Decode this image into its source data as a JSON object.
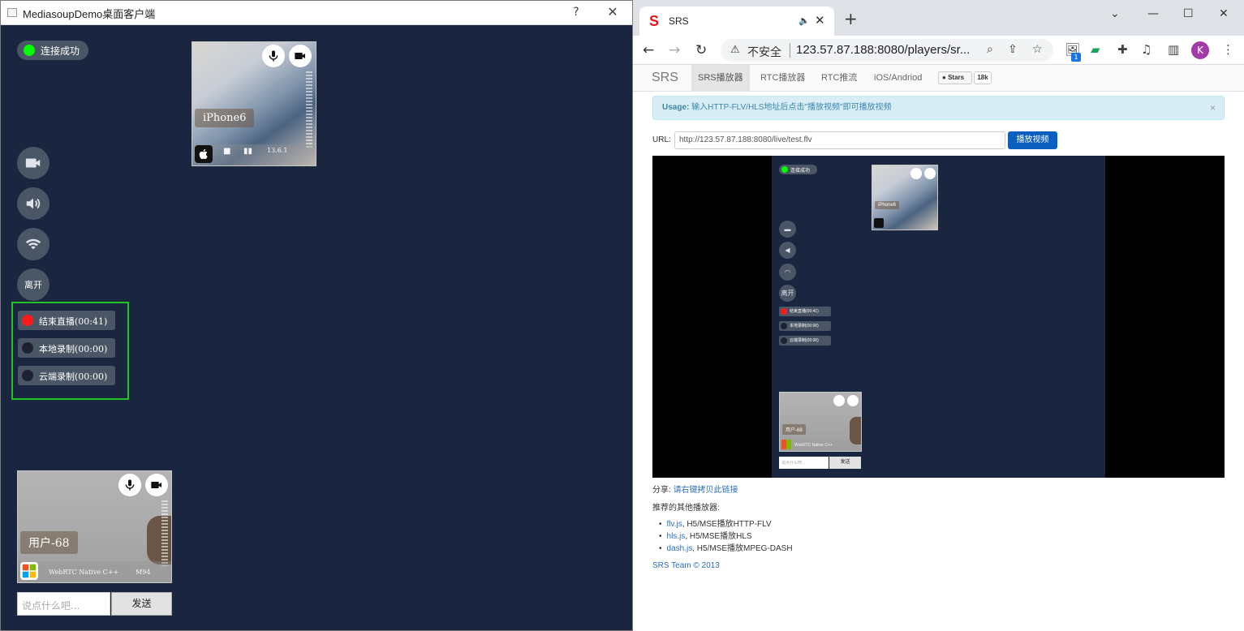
{
  "left_window": {
    "title": "MediasoupDemo桌面客户端",
    "help": "?",
    "close": "✕",
    "status_text": "连接成功",
    "leave_label": "离开",
    "recordings": [
      {
        "label": "结束直播(00:41)",
        "color": "#ff1a1a",
        "active": true
      },
      {
        "label": "本地录制(00:00)",
        "color": "#1d2230",
        "active": false
      },
      {
        "label": "云端录制(00:00)",
        "color": "#1d2230",
        "active": false
      }
    ],
    "remote_tile": {
      "name": "iPhone6",
      "version": "13.6.1"
    },
    "local_tile": {
      "name": "用户-68",
      "sdk": "WebRTC Native C++",
      "version": "M94"
    },
    "chat_placeholder": "说点什么吧...",
    "send_label": "发送"
  },
  "browser": {
    "tab_title": "SRS",
    "new_tab": "+",
    "insecure_label": "不安全",
    "url": "123.57.87.188:8080/players/sr...",
    "profile_initial": "K",
    "extension_badge": "1",
    "page": {
      "brand": "SRS",
      "nav": [
        "SRS播放器",
        "RTC播放器",
        "RTC推流",
        "iOS/Andriod"
      ],
      "github_stars_label": "Stars",
      "github_stars_count": "18k",
      "usage_label": "Usage:",
      "usage_text": "输入HTTP-FLV/HLS地址后点击\"播放视频\"即可播放视频",
      "url_label": "URL:",
      "url_value": "http://123.57.87.188:8080/live/test.flv",
      "play_label": "播放视频",
      "share_label": "分享:",
      "share_link": "请右键拷贝此链接",
      "recommend_label": "推荐的其他播放器:",
      "players": [
        {
          "name": "flv.js",
          "desc": ", H5/MSE播放HTTP-FLV"
        },
        {
          "name": "hls.js",
          "desc": ", H5/MSE播放HLS"
        },
        {
          "name": "dash.js",
          "desc": ", H5/MSE播放MPEG-DASH"
        }
      ],
      "footer": "SRS Team © 2013"
    }
  },
  "mini_preview": {
    "status_text": "连接成功",
    "leave_label": "离开",
    "recordings": [
      "结束直播(00:41)",
      "本地录制(00:00)",
      "云端录制(00:00)"
    ],
    "remote_name": "iPhone6",
    "local_name": "用户-68",
    "local_sdk": "WebRTC Native C++",
    "chat_placeholder": "说点什么吧...",
    "send_label": "发送"
  }
}
